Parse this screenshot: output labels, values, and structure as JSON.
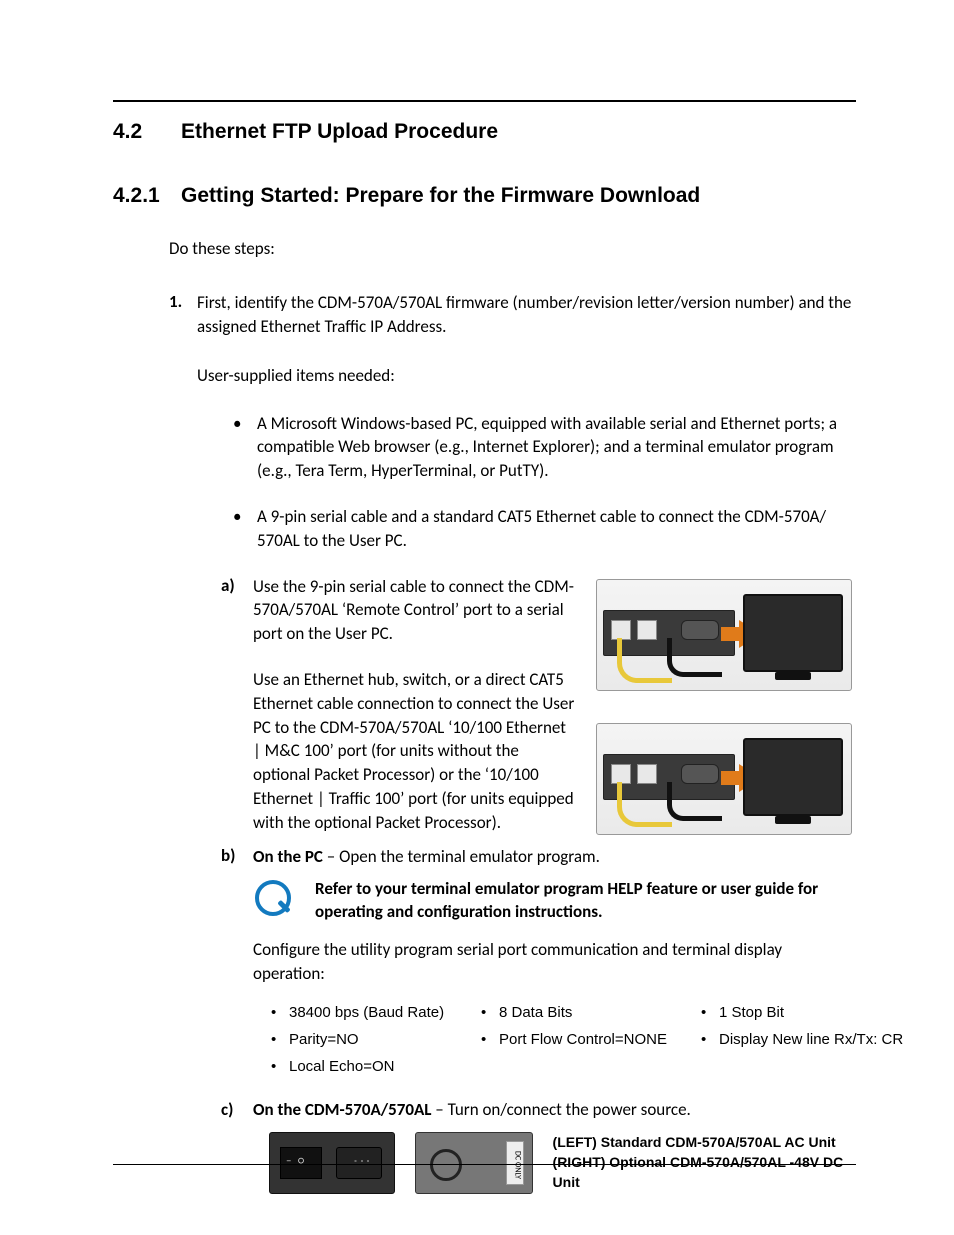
{
  "section": {
    "num": "4.2",
    "title": "Ethernet FTP Upload Procedure"
  },
  "subsection": {
    "num": "4.2.1",
    "title": "Getting Started: Prepare for the Firmware Download"
  },
  "intro": "Do these steps:",
  "step1": {
    "num": "1.",
    "text": "First, identify the CDM-570A/570AL firmware (number/revision letter/version number) and the assigned Ethernet Traffic IP Address."
  },
  "user_items_intro": "User-supplied items needed:",
  "bullets": [
    "A Microsoft Windows-based PC, equipped with available serial and Ethernet ports; a compatible Web browser (e.g., Internet Explorer); and a terminal emulator program (e.g., Tera Term, HyperTerminal, or PutTY).",
    "A 9-pin serial cable and a standard CAT5 Ethernet cable to connect the CDM-570A/ 570AL to the User PC."
  ],
  "step_a": {
    "label": "a)",
    "p1": "Use the 9-pin serial cable to connect the CDM-570A/570AL ‘Remote Control’ port to a serial port on the User PC.",
    "p2": "Use an Ethernet hub, switch, or a direct CAT5 Ethernet cable connection to connect the User PC to the CDM-570A/570AL ‘10/100 Ethernet | M&C 100’ port (for units without the optional Packet Processor) or the ‘10/100 Ethernet | Traffic 100’ port (for units equipped with the optional Packet Processor)."
  },
  "step_b": {
    "label": "b)",
    "line_prefix_bold": "On the PC",
    "line_rest": " – Open the terminal emulator program.",
    "note": "Refer to your terminal emulator program HELP feature or user guide for operating and configuration instructions.",
    "config_line": "Configure the utility program serial port communication and terminal display operation:"
  },
  "settings": {
    "r1c1": "38400 bps (Baud Rate)",
    "r1c2": "8 Data Bits",
    "r1c3": "1 Stop Bit",
    "r2c1": "Parity=NO",
    "r2c2": "Port Flow Control=NONE",
    "r2c3": "Display New line Rx/Tx: CR",
    "r3c1": "Local Echo=ON"
  },
  "step_c": {
    "label": "c)",
    "line_prefix_bold": "On the CDM-570A/570AL",
    "line_rest": " – Turn on/connect the power source.",
    "caption_left": "(LEFT) Standard CDM-570A/570AL AC Unit",
    "caption_right": "(RIGHT) Optional CDM-570A/570AL -48V DC Unit",
    "dc_tag": "DC ONLY"
  }
}
